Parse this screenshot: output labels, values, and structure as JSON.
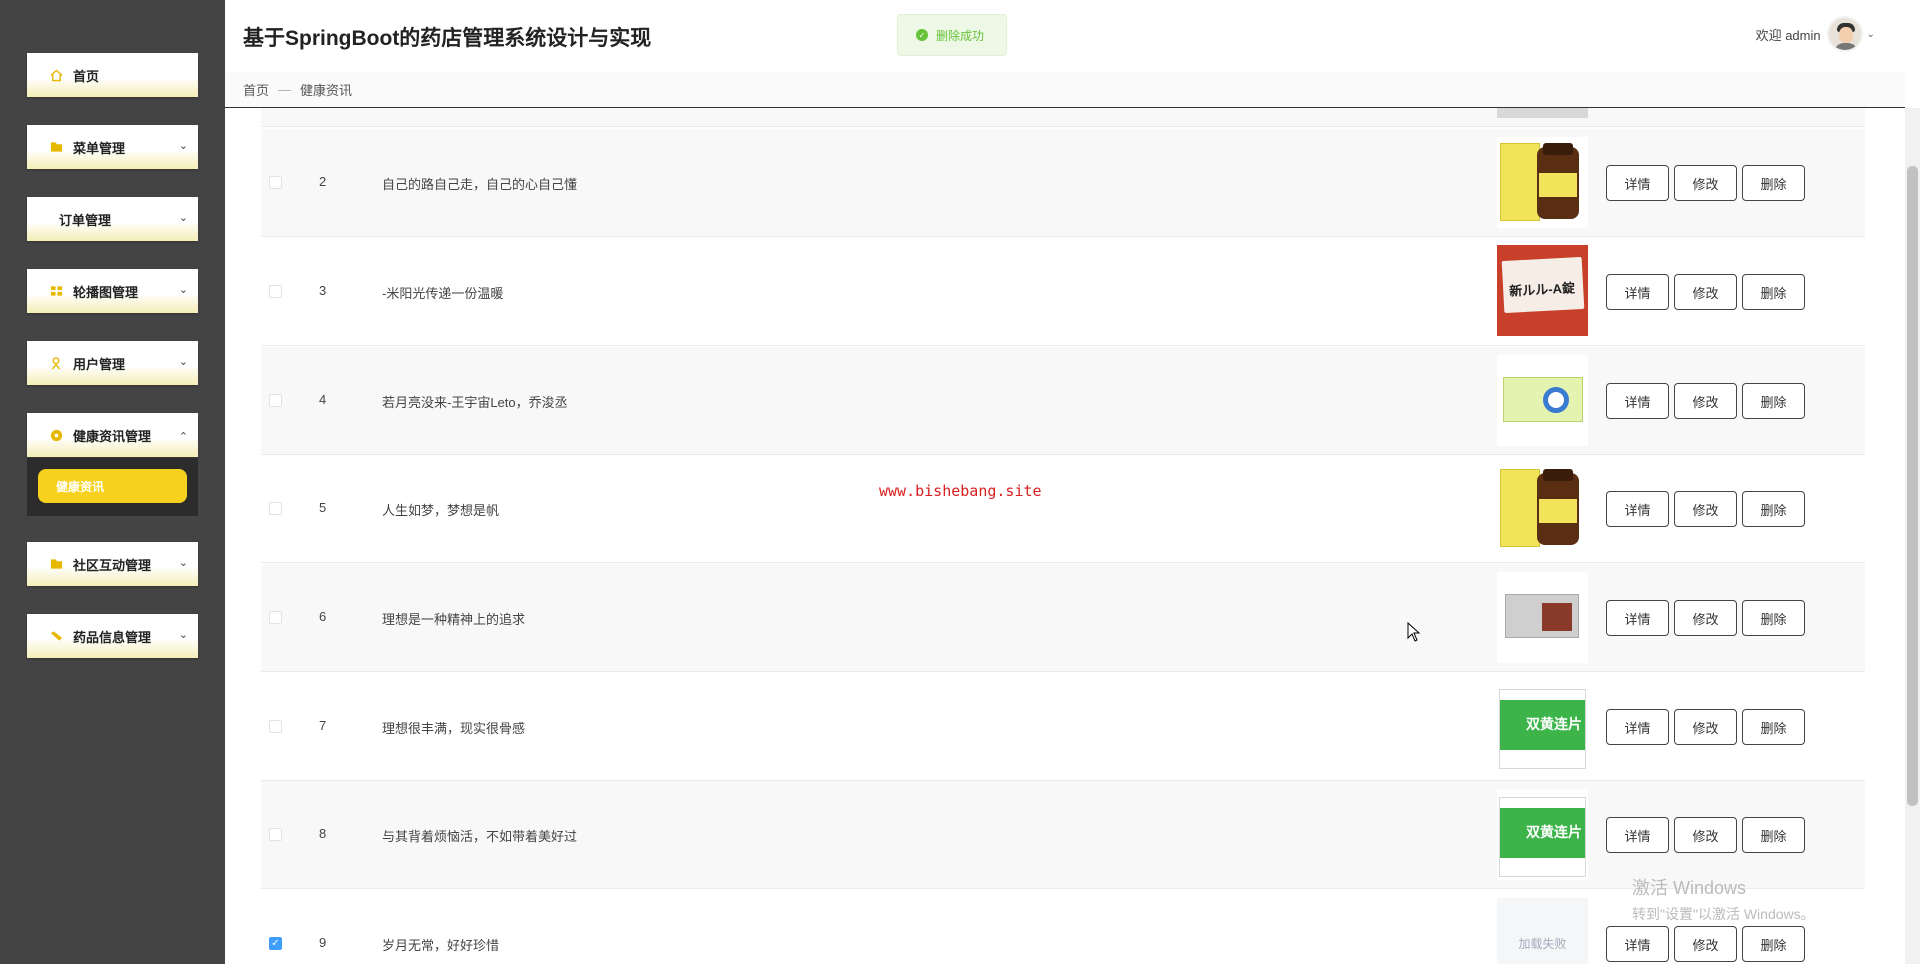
{
  "app": {
    "title": "基于SpringBoot的药店管理系统设计与实现",
    "toast": "删除成功",
    "welcome": "欢迎 admin",
    "watermark": "www.bishebang.site"
  },
  "sidebar": {
    "items": [
      {
        "label": "首页",
        "icon": "home-icon",
        "expandable": false
      },
      {
        "label": "菜单管理",
        "icon": "folder-icon",
        "expandable": true
      },
      {
        "label": "订单管理",
        "icon": "",
        "expandable": true
      },
      {
        "label": "轮播图管理",
        "icon": "grid-icon",
        "expandable": true
      },
      {
        "label": "用户管理",
        "icon": "user-icon",
        "expandable": true
      },
      {
        "label": "健康资讯管理",
        "icon": "info-circle-icon",
        "expandable": true,
        "expanded": true
      },
      {
        "label": "社区互动管理",
        "icon": "folder-icon",
        "expandable": true
      },
      {
        "label": "药品信息管理",
        "icon": "pill-icon",
        "expandable": true
      }
    ],
    "active_sub": "健康资讯"
  },
  "breadcrumb": {
    "home": "首页",
    "separator": "—",
    "current": "健康资讯"
  },
  "table": {
    "action_labels": {
      "detail": "详情",
      "edit": "修改",
      "delete": "删除"
    },
    "rows": [
      {
        "num": "2",
        "title": "自己的路自己走，自己的心自己懂",
        "image": "yellow-medicine-jar",
        "checked": false
      },
      {
        "num": "3",
        "title": "-米阳光传递一份温暖",
        "image": "red-medicine-box",
        "checked": false
      },
      {
        "num": "4",
        "title": "若月亮没来-王宇宙Leto，乔浚丞",
        "image": "green-pill-box",
        "checked": false
      },
      {
        "num": "5",
        "title": "人生如梦，梦想是帆",
        "image": "yellow-medicine-jar",
        "checked": false
      },
      {
        "num": "6",
        "title": "理想是一种精神上的追求",
        "image": "grey-capsule-box",
        "checked": false
      },
      {
        "num": "7",
        "title": "理想很丰满，现实很骨感",
        "image": "green-tablet-box",
        "checked": false
      },
      {
        "num": "8",
        "title": "与其背着烦恼活，不如带着美好过",
        "image": "green-tablet-box",
        "checked": false
      },
      {
        "num": "9",
        "title": "岁月无常，好好珍惜",
        "image": "load-failed",
        "image_text": "加载失败",
        "checked": true
      }
    ]
  },
  "thumb_text": {
    "red": "新ルル-A錠",
    "green": "双黄连片"
  },
  "activation": {
    "line1": "激活 Windows",
    "line2": "转到\"设置\"以激活 Windows。"
  }
}
